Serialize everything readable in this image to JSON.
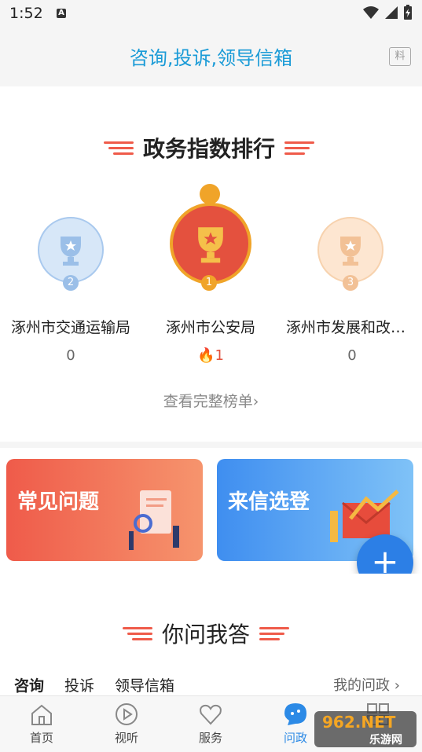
{
  "status_bar": {
    "time": "1:52",
    "notification": "A"
  },
  "header": {
    "title": "咨询,投诉,领导信箱",
    "edit_icon_label": "料"
  },
  "ranking": {
    "title": "政务指数排行",
    "items": [
      {
        "rank": "2",
        "name": "涿州市交通运输局",
        "score": "0"
      },
      {
        "rank": "1",
        "name": "涿州市公安局",
        "score": "1"
      },
      {
        "rank": "3",
        "name": "涿州市发展和改…",
        "score": "0"
      }
    ],
    "view_all": "查看完整榜单"
  },
  "banners": [
    {
      "label": "常见问题"
    },
    {
      "label": "来信选登"
    }
  ],
  "qa": {
    "title": "你问我答",
    "tabs": [
      "咨询",
      "投诉",
      "领导信箱"
    ],
    "my_link": "我的问政"
  },
  "nav": [
    {
      "label": "首页",
      "icon": "home-icon"
    },
    {
      "label": "视听",
      "icon": "play-icon"
    },
    {
      "label": "服务",
      "icon": "heart-icon"
    },
    {
      "label": "问政",
      "icon": "chat-icon"
    },
    {
      "label": "",
      "icon": "grid-icon"
    }
  ],
  "watermark": {
    "brand": "962.NET",
    "sub": "乐游网"
  },
  "colors": {
    "accent": "#1a9bd7",
    "red": "#ef5b4a",
    "gold": "#f0a429",
    "blue_nav": "#2c8ae6"
  }
}
